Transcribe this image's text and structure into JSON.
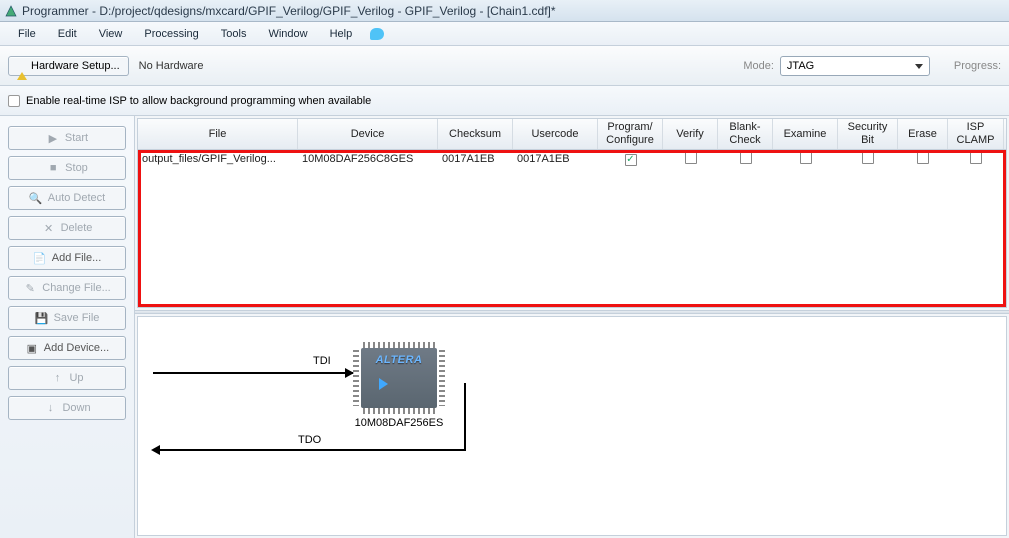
{
  "title": "Programmer - D:/project/qdesigns/mxcard/GPIF_Verilog/GPIF_Verilog - GPIF_Verilog - [Chain1.cdf]*",
  "menu": [
    "File",
    "Edit",
    "View",
    "Processing",
    "Tools",
    "Window",
    "Help"
  ],
  "toolbar": {
    "hw_setup": "Hardware Setup...",
    "hw_status": "No Hardware",
    "mode_label": "Mode:",
    "mode_value": "JTAG",
    "progress_label": "Progress:"
  },
  "option_checkbox": "Enable real-time ISP to allow background programming when available",
  "left_buttons": {
    "start": "Start",
    "stop": "Stop",
    "auto_detect": "Auto Detect",
    "delete": "Delete",
    "add_file": "Add File...",
    "change_file": "Change File...",
    "save_file": "Save File",
    "add_device": "Add Device...",
    "up": "Up",
    "down": "Down"
  },
  "table": {
    "headers": {
      "file": "File",
      "device": "Device",
      "checksum": "Checksum",
      "usercode": "Usercode",
      "program": "Program/\nConfigure",
      "verify": "Verify",
      "blank": "Blank-\nCheck",
      "examine": "Examine",
      "security": "Security\nBit",
      "erase": "Erase",
      "isp": "ISP\nCLAMP"
    },
    "row": {
      "file": "output_files/GPIF_Verilog...",
      "device": "10M08DAF256C8GES",
      "checksum": "0017A1EB",
      "usercode": "0017A1EB",
      "program_checked": true,
      "verify_checked": false,
      "blank_checked": false,
      "examine_checked": false,
      "security_checked": false,
      "erase_checked": false,
      "isp_checked": false
    }
  },
  "chain": {
    "chip_logo": "ALTERA",
    "chip_label": "10M08DAF256ES",
    "tdi": "TDI",
    "tdo": "TDO"
  }
}
